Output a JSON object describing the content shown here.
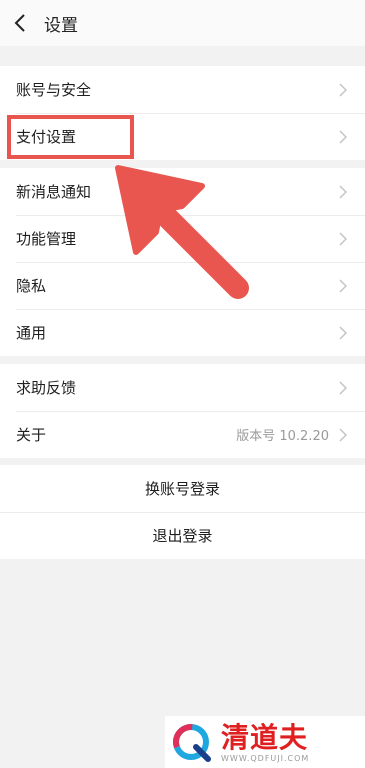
{
  "header": {
    "title": "设置"
  },
  "groups": [
    {
      "items": [
        {
          "label": "账号与安全"
        },
        {
          "label": "支付设置"
        }
      ]
    },
    {
      "items": [
        {
          "label": "新消息通知"
        },
        {
          "label": "功能管理"
        },
        {
          "label": "隐私"
        },
        {
          "label": "通用"
        }
      ]
    },
    {
      "items": [
        {
          "label": "求助反馈"
        },
        {
          "label": "关于",
          "value": "版本号 10.2.20"
        }
      ]
    }
  ],
  "actions": {
    "switch_account": "换账号登录",
    "logout": "退出登录"
  },
  "annotation": {
    "color": "#e8564f",
    "target": "支付设置"
  },
  "watermark": {
    "name": "清道夫",
    "url": "WWW.QDFUJI.COM",
    "color": "#e02020"
  }
}
